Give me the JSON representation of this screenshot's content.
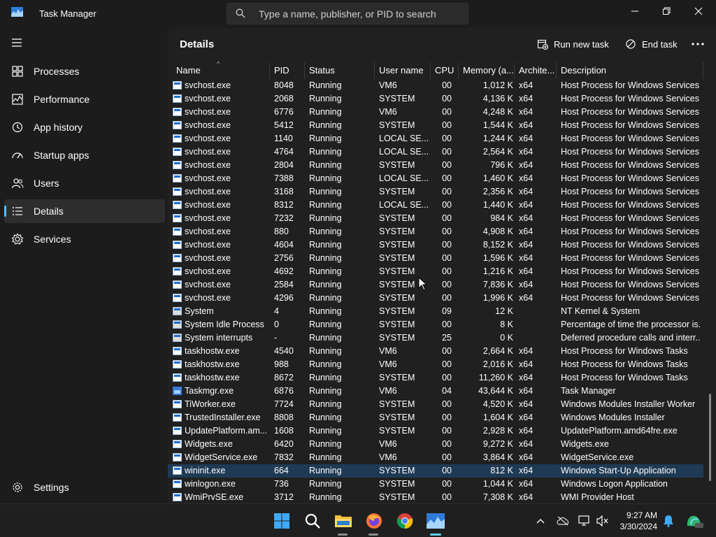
{
  "app": {
    "title": "Task Manager"
  },
  "search": {
    "placeholder": "Type a name, publisher, or PID to search"
  },
  "sidebar": {
    "items": [
      {
        "label": "Processes",
        "icon": "processes-grid-icon"
      },
      {
        "label": "Performance",
        "icon": "performance-chart-icon"
      },
      {
        "label": "App history",
        "icon": "history-clock-icon"
      },
      {
        "label": "Startup apps",
        "icon": "startup-gauge-icon"
      },
      {
        "label": "Users",
        "icon": "users-icon"
      },
      {
        "label": "Details",
        "icon": "details-list-icon",
        "active": true
      },
      {
        "label": "Services",
        "icon": "services-puzzle-icon"
      }
    ],
    "settings_label": "Settings"
  },
  "page": {
    "title": "Details"
  },
  "toolbar": {
    "run_new_task": "Run new task",
    "end_task": "End task"
  },
  "table": {
    "columns": [
      "Name",
      "PID",
      "Status",
      "User name",
      "CPU",
      "Memory (a...",
      "Archite...",
      "Description"
    ],
    "rows": [
      [
        "svchost.exe",
        "8048",
        "Running",
        "VM6",
        "00",
        "1,012 K",
        "x64",
        "Host Process for Windows Services"
      ],
      [
        "svchost.exe",
        "2068",
        "Running",
        "SYSTEM",
        "00",
        "4,136 K",
        "x64",
        "Host Process for Windows Services"
      ],
      [
        "svchost.exe",
        "6776",
        "Running",
        "VM6",
        "00",
        "4,248 K",
        "x64",
        "Host Process for Windows Services"
      ],
      [
        "svchost.exe",
        "5412",
        "Running",
        "SYSTEM",
        "00",
        "1,544 K",
        "x64",
        "Host Process for Windows Services"
      ],
      [
        "svchost.exe",
        "1140",
        "Running",
        "LOCAL SE...",
        "00",
        "1,244 K",
        "x64",
        "Host Process for Windows Services"
      ],
      [
        "svchost.exe",
        "4764",
        "Running",
        "LOCAL SE...",
        "00",
        "2,564 K",
        "x64",
        "Host Process for Windows Services"
      ],
      [
        "svchost.exe",
        "2804",
        "Running",
        "SYSTEM",
        "00",
        "796 K",
        "x64",
        "Host Process for Windows Services"
      ],
      [
        "svchost.exe",
        "7388",
        "Running",
        "LOCAL SE...",
        "00",
        "1,460 K",
        "x64",
        "Host Process for Windows Services"
      ],
      [
        "svchost.exe",
        "3168",
        "Running",
        "SYSTEM",
        "00",
        "2,356 K",
        "x64",
        "Host Process for Windows Services"
      ],
      [
        "svchost.exe",
        "8312",
        "Running",
        "LOCAL SE...",
        "00",
        "1,440 K",
        "x64",
        "Host Process for Windows Services"
      ],
      [
        "svchost.exe",
        "7232",
        "Running",
        "SYSTEM",
        "00",
        "984 K",
        "x64",
        "Host Process for Windows Services"
      ],
      [
        "svchost.exe",
        "880",
        "Running",
        "SYSTEM",
        "00",
        "4,908 K",
        "x64",
        "Host Process for Windows Services"
      ],
      [
        "svchost.exe",
        "4604",
        "Running",
        "SYSTEM",
        "00",
        "8,152 K",
        "x64",
        "Host Process for Windows Services"
      ],
      [
        "svchost.exe",
        "2756",
        "Running",
        "SYSTEM",
        "00",
        "1,596 K",
        "x64",
        "Host Process for Windows Services"
      ],
      [
        "svchost.exe",
        "4692",
        "Running",
        "SYSTEM",
        "00",
        "1,216 K",
        "x64",
        "Host Process for Windows Services"
      ],
      [
        "svchost.exe",
        "2584",
        "Running",
        "SYSTEM",
        "00",
        "7,836 K",
        "x64",
        "Host Process for Windows Services"
      ],
      [
        "svchost.exe",
        "4296",
        "Running",
        "SYSTEM",
        "00",
        "1,996 K",
        "x64",
        "Host Process for Windows Services"
      ],
      [
        "System",
        "4",
        "Running",
        "SYSTEM",
        "09",
        "12 K",
        "",
        "NT Kernel & System"
      ],
      [
        "System Idle Process",
        "0",
        "Running",
        "SYSTEM",
        "00",
        "8 K",
        "",
        "Percentage of time the processor is..."
      ],
      [
        "System interrupts",
        "-",
        "Running",
        "SYSTEM",
        "25",
        "0 K",
        "",
        "Deferred procedure calls and interr..."
      ],
      [
        "taskhostw.exe",
        "4540",
        "Running",
        "VM6",
        "00",
        "2,664 K",
        "x64",
        "Host Process for Windows Tasks"
      ],
      [
        "taskhostw.exe",
        "988",
        "Running",
        "VM6",
        "00",
        "2,016 K",
        "x64",
        "Host Process for Windows Tasks"
      ],
      [
        "taskhostw.exe",
        "8672",
        "Running",
        "SYSTEM",
        "00",
        "11,260 K",
        "x64",
        "Host Process for Windows Tasks"
      ],
      [
        "Taskmgr.exe",
        "6876",
        "Running",
        "VM6",
        "04",
        "43,644 K",
        "x64",
        "Task Manager"
      ],
      [
        "TiWorker.exe",
        "7724",
        "Running",
        "SYSTEM",
        "00",
        "4,520 K",
        "x64",
        "Windows Modules Installer Worker"
      ],
      [
        "TrustedInstaller.exe",
        "8808",
        "Running",
        "SYSTEM",
        "00",
        "1,604 K",
        "x64",
        "Windows Modules Installer"
      ],
      [
        "UpdatePlatform.am...",
        "1608",
        "Running",
        "SYSTEM",
        "00",
        "2,928 K",
        "x64",
        "UpdatePlatform.amd64fre.exe"
      ],
      [
        "Widgets.exe",
        "6420",
        "Running",
        "VM6",
        "00",
        "9,272 K",
        "x64",
        "Widgets.exe"
      ],
      [
        "WidgetService.exe",
        "7832",
        "Running",
        "VM6",
        "00",
        "3,864 K",
        "x64",
        "WidgetService.exe"
      ],
      [
        "wininit.exe",
        "664",
        "Running",
        "SYSTEM",
        "00",
        "812 K",
        "x64",
        "Windows Start-Up Application"
      ],
      [
        "winlogon.exe",
        "736",
        "Running",
        "SYSTEM",
        "00",
        "1,044 K",
        "x64",
        "Windows Logon Application"
      ],
      [
        "WmiPrvSE.exe",
        "3712",
        "Running",
        "SYSTEM",
        "00",
        "7,308 K",
        "x64",
        "WMI Provider Host"
      ]
    ],
    "selected_index": 29
  },
  "taskbar": {
    "apps": [
      "windows-start-icon",
      "search-icon",
      "file-explorer-icon",
      "firefox-icon",
      "chrome-icon",
      "task-manager-icon"
    ],
    "time": "9:27 AM",
    "date": "3/30/2024"
  },
  "colors": {
    "accent": "#4cc2ff",
    "selection": "#1f3a54",
    "background": "#202020",
    "sidebar": "#1c1c1c"
  }
}
